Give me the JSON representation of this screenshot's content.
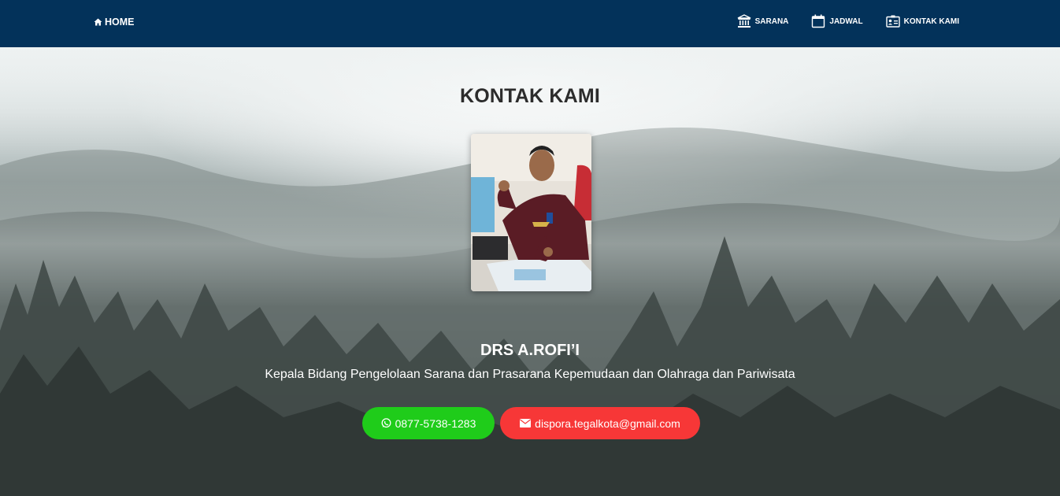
{
  "nav": {
    "home_label": "HOME",
    "items": [
      {
        "label": "SARANA",
        "icon": "bank-icon"
      },
      {
        "label": "JADWAL",
        "icon": "calendar-icon"
      },
      {
        "label": "KONTAK KAMI",
        "icon": "contact-card-icon"
      }
    ]
  },
  "main": {
    "title": "KONTAK KAMI",
    "person": {
      "name": "DRS A.ROFI’I",
      "role": "Kepala Bidang Pengelolaan Sarana dan Prasarana Kepemudaan dan Olahraga dan Pariwisata"
    },
    "buttons": {
      "whatsapp": "0877-5738-1283",
      "email": "dispora.tegalkota@gmail.com"
    }
  },
  "colors": {
    "navbar": "#03325a",
    "whatsapp": "#1fcc1a",
    "email": "#f73737"
  }
}
